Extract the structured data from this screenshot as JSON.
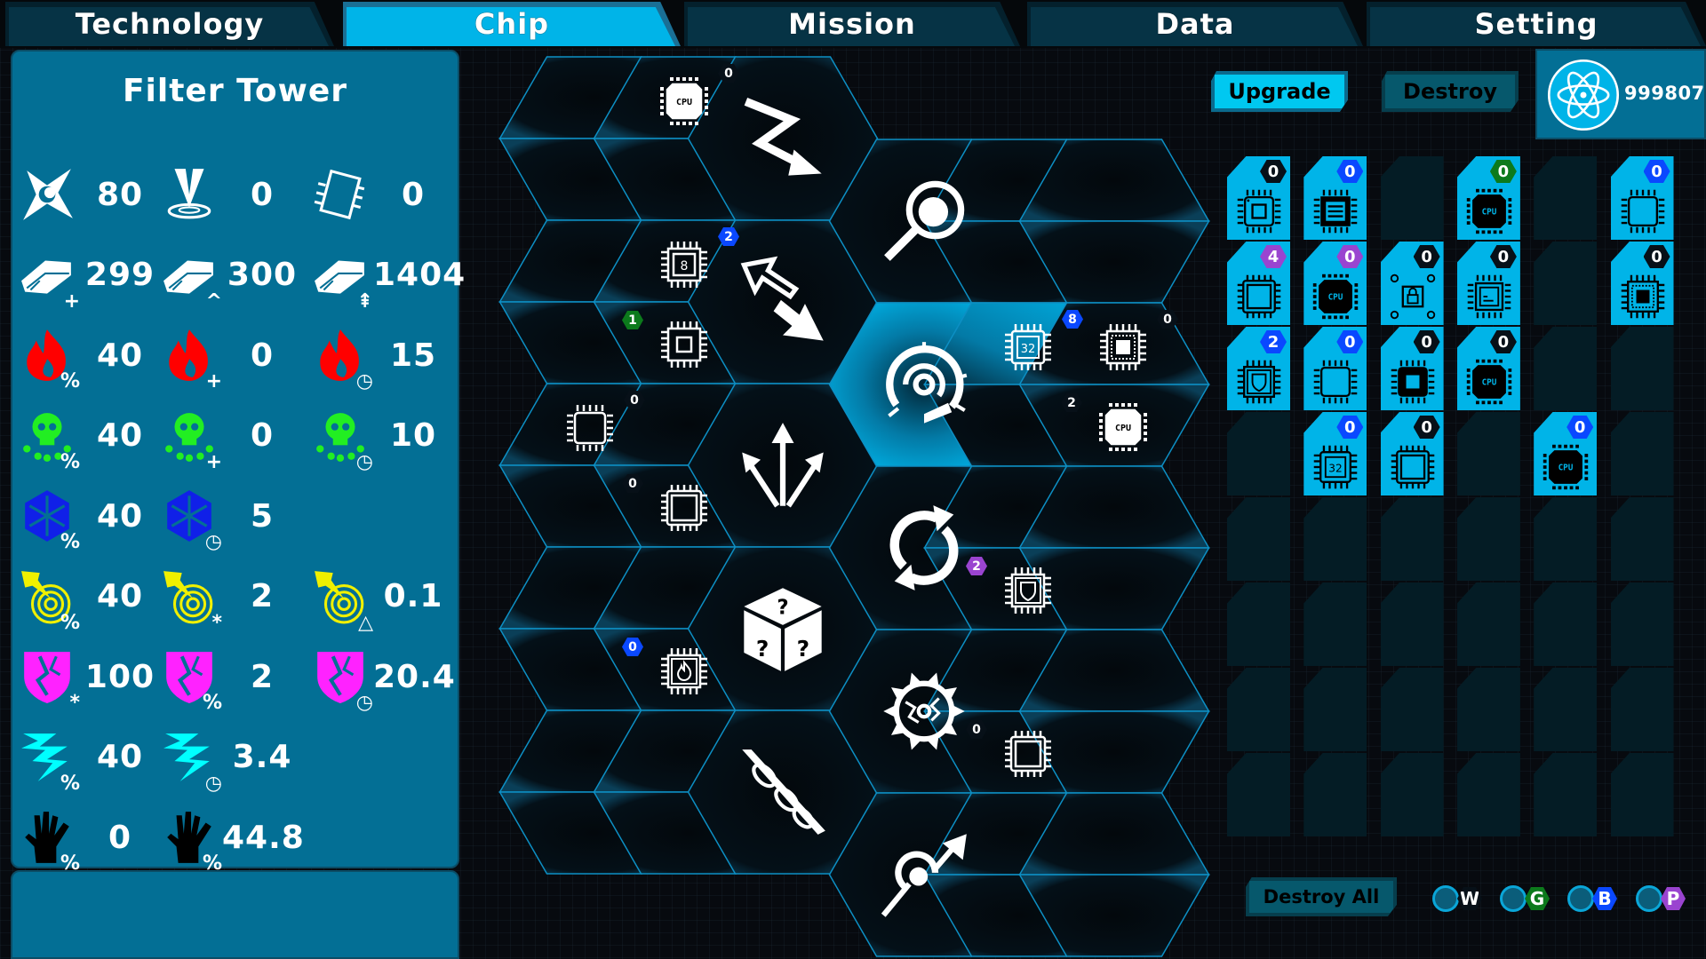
{
  "tabs": [
    {
      "label": "Technology",
      "active": false
    },
    {
      "label": "Chip",
      "active": true
    },
    {
      "label": "Mission",
      "active": false
    },
    {
      "label": "Data",
      "active": false
    },
    {
      "label": "Setting",
      "active": false
    }
  ],
  "panel": {
    "title": "Filter Tower",
    "stats": [
      {
        "icon": "shuriken-icon",
        "color": "#ffffff",
        "sub": "",
        "value": "80"
      },
      {
        "icon": "drop-target-icon",
        "color": "#ffffff",
        "sub": "",
        "value": "0"
      },
      {
        "icon": "chip-slot-icon",
        "color": "#ffffff",
        "sub": "",
        "value": "0"
      },
      {
        "icon": "ingot-icon",
        "color": "#ffffff",
        "sub": "+",
        "value": "299"
      },
      {
        "icon": "ingot-icon",
        "color": "#ffffff",
        "sub": "^",
        "value": "300"
      },
      {
        "icon": "ingot-icon",
        "color": "#ffffff",
        "sub": "⇞",
        "value": "1404"
      },
      {
        "icon": "fire-icon",
        "color": "#ff0000",
        "sub": "%",
        "value": "40"
      },
      {
        "icon": "fire-icon",
        "color": "#ff0000",
        "sub": "+",
        "value": "0"
      },
      {
        "icon": "fire-icon",
        "color": "#ff0000",
        "sub": "◷",
        "value": "15"
      },
      {
        "icon": "poison-skull-icon",
        "color": "#22ee22",
        "sub": "%",
        "value": "40"
      },
      {
        "icon": "poison-skull-icon",
        "color": "#22ee22",
        "sub": "+",
        "value": "0"
      },
      {
        "icon": "poison-skull-icon",
        "color": "#22ee22",
        "sub": "◷",
        "value": "10"
      },
      {
        "icon": "snowflake-icon",
        "color": "#1020e8",
        "sub": "%",
        "value": "40"
      },
      {
        "icon": "snowflake-icon",
        "color": "#1020e8",
        "sub": "◷",
        "value": "5"
      },
      null,
      {
        "icon": "radar-strike-icon",
        "color": "#f0f000",
        "sub": "%",
        "value": "40"
      },
      {
        "icon": "radar-strike-icon",
        "color": "#f0f000",
        "sub": "*",
        "value": "2"
      },
      {
        "icon": "radar-strike-icon",
        "color": "#f0f000",
        "sub": "△",
        "value": "0.1"
      },
      {
        "icon": "broken-shield-icon",
        "color": "#ff22ff",
        "sub": "*",
        "value": "100"
      },
      {
        "icon": "broken-shield-icon",
        "color": "#ff22ff",
        "sub": "%",
        "value": "2"
      },
      {
        "icon": "broken-shield-icon",
        "color": "#ff22ff",
        "sub": "◷",
        "value": "20.4"
      },
      {
        "icon": "lightning-icon",
        "color": "#00ffff",
        "sub": "%",
        "value": "40"
      },
      {
        "icon": "lightning-icon",
        "color": "#00ffff",
        "sub": "◷",
        "value": "3.4"
      },
      null,
      {
        "icon": "hand-icon",
        "color": "#000000",
        "sub": "%",
        "value": "0"
      },
      {
        "icon": "hand-icon",
        "color": "#000000",
        "sub": "%",
        "value": "44.8"
      },
      null
    ]
  },
  "board": {
    "skills": [
      {
        "col": "C",
        "row": 0,
        "icon": "zigzag-arrow-icon"
      },
      {
        "col": "C",
        "row": 1,
        "icon": "bidirectional-arrow-icon"
      },
      {
        "col": "C",
        "row": 2,
        "icon": "split-arrows-icon"
      },
      {
        "col": "C",
        "row": 3,
        "icon": "mystery-dice-icon"
      },
      {
        "col": "C",
        "row": 4,
        "icon": "piercing-missile-icon"
      },
      {
        "col": "D",
        "row": 0,
        "icon": "magnifier-icon"
      },
      {
        "col": "D",
        "row": 1,
        "icon": "target-eye-icon",
        "selected": true
      },
      {
        "col": "D",
        "row": 2,
        "icon": "refresh-icon"
      },
      {
        "col": "D",
        "row": 3,
        "icon": "spiked-sun-icon"
      },
      {
        "col": "D",
        "row": 4,
        "icon": "orbit-arrow-icon"
      }
    ],
    "chips": [
      {
        "col": "B",
        "row": 0,
        "half": "upper",
        "chip": "cpu",
        "level": "0",
        "rarity": "black"
      },
      {
        "col": "B",
        "row": 1,
        "half": "upper",
        "chip": "n8",
        "level": "2",
        "rarity": "blue"
      },
      {
        "col": "B",
        "row": 1,
        "half": "lower",
        "chip": "core",
        "level": "1",
        "rarity": "green"
      },
      {
        "col": "A",
        "row": 2,
        "half": "upper",
        "chip": "outline",
        "level": "0",
        "rarity": "black"
      },
      {
        "col": "B",
        "row": 2,
        "half": "lower",
        "chip": "square",
        "level": "0",
        "rarity": "black"
      },
      {
        "col": "B",
        "row": 3,
        "half": "lower",
        "chip": "fire",
        "level": "0",
        "rarity": "blue"
      },
      {
        "col": "E",
        "row": 1,
        "half": "upper",
        "chip": "n32",
        "level": "8",
        "rarity": "blue",
        "selected": true
      },
      {
        "col": "F",
        "row": 1,
        "half": "upper",
        "chip": "dotted",
        "level": "0",
        "rarity": "black"
      },
      {
        "col": "F",
        "row": 1,
        "half": "lower",
        "chip": "cpu",
        "level": "2",
        "rarity": "black"
      },
      {
        "col": "E",
        "row": 2,
        "half": "lower",
        "chip": "shield",
        "level": "2",
        "rarity": "purple"
      },
      {
        "col": "E",
        "row": 3,
        "half": "lower",
        "chip": "square",
        "level": "0",
        "rarity": "black"
      }
    ]
  },
  "actions": {
    "upgrade_label": "Upgrade",
    "destroy_label": "Destroy",
    "destroy_all_label": "Destroy All"
  },
  "currency": {
    "icon": "atom-icon",
    "value": "999807"
  },
  "inventory": {
    "columns": 6,
    "rows": 8,
    "items": [
      {
        "r": 0,
        "c": 0,
        "chip": "outline-dot",
        "level": "0",
        "rarity": "black"
      },
      {
        "r": 0,
        "c": 1,
        "chip": "lines",
        "level": "0",
        "rarity": "blue"
      },
      {
        "r": 0,
        "c": 3,
        "chip": "cpu",
        "level": "0",
        "rarity": "green"
      },
      {
        "r": 0,
        "c": 5,
        "chip": "outline",
        "level": "0",
        "rarity": "blue"
      },
      {
        "r": 1,
        "c": 0,
        "chip": "square",
        "level": "4",
        "rarity": "purple"
      },
      {
        "r": 1,
        "c": 1,
        "chip": "cpu",
        "level": "0",
        "rarity": "purple"
      },
      {
        "r": 1,
        "c": 2,
        "chip": "lock",
        "level": "0",
        "rarity": "black"
      },
      {
        "r": 1,
        "c": 3,
        "chip": "terminal",
        "level": "0",
        "rarity": "black"
      },
      {
        "r": 1,
        "c": 5,
        "chip": "dotted",
        "level": "0",
        "rarity": "black"
      },
      {
        "r": 2,
        "c": 0,
        "chip": "shield",
        "level": "2",
        "rarity": "blue"
      },
      {
        "r": 2,
        "c": 1,
        "chip": "outline",
        "level": "0",
        "rarity": "blue"
      },
      {
        "r": 2,
        "c": 2,
        "chip": "filled",
        "level": "0",
        "rarity": "black"
      },
      {
        "r": 2,
        "c": 3,
        "chip": "cpu",
        "level": "0",
        "rarity": "black"
      },
      {
        "r": 3,
        "c": 1,
        "chip": "n32",
        "level": "0",
        "rarity": "blue"
      },
      {
        "r": 3,
        "c": 2,
        "chip": "square",
        "level": "0",
        "rarity": "black"
      },
      {
        "r": 3,
        "c": 4,
        "chip": "cpu",
        "level": "0",
        "rarity": "blue"
      }
    ]
  },
  "filters": [
    {
      "letter": "W",
      "rarity": "white",
      "color": "#071018"
    },
    {
      "letter": "G",
      "rarity": "green",
      "color": "#0c7a1c"
    },
    {
      "letter": "B",
      "rarity": "blue",
      "color": "#0a48ff"
    },
    {
      "letter": "P",
      "rarity": "purple",
      "color": "#9a44d0"
    }
  ]
}
